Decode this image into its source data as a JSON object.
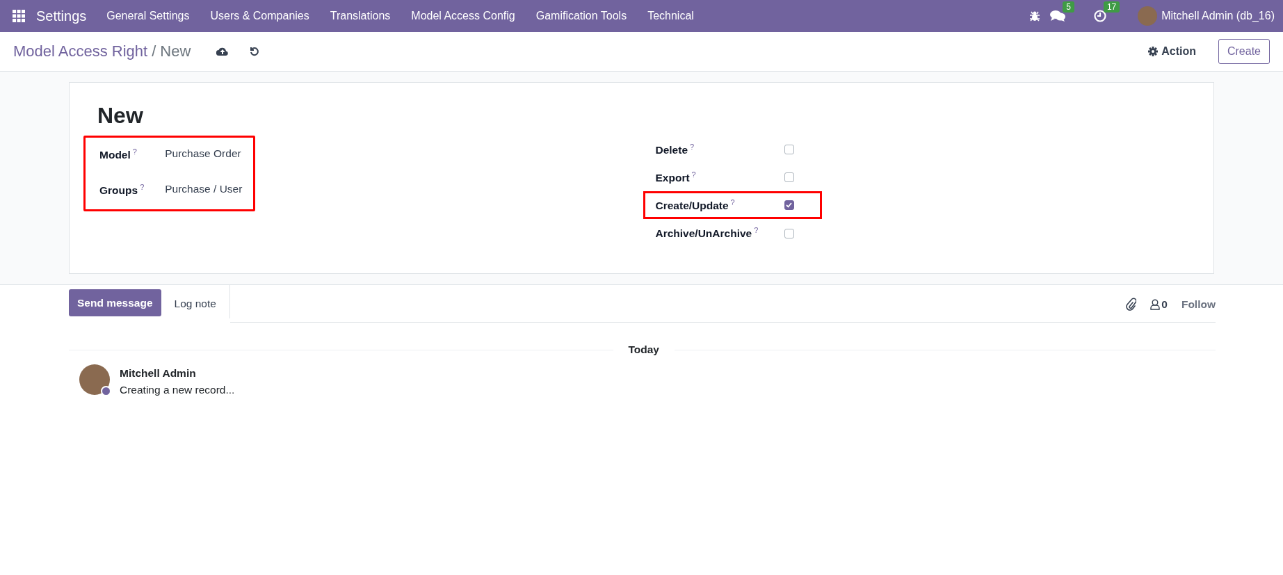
{
  "navbar": {
    "app": "Settings",
    "menus": [
      "General Settings",
      "Users & Companies",
      "Translations",
      "Model Access Config",
      "Gamification Tools",
      "Technical"
    ],
    "messages_badge": "5",
    "activities_badge": "17",
    "user": "Mitchell Admin (db_16)"
  },
  "control_panel": {
    "breadcrumb": "Model Access Right",
    "separator": "/",
    "current": "New",
    "action": "Action",
    "create": "Create"
  },
  "form": {
    "title": "New",
    "main_fields_highlighted": true,
    "main_fields": [
      {
        "label": "Model",
        "help": "?",
        "value": "Purchase Order"
      },
      {
        "label": "Groups",
        "help": "?",
        "value": "Purchase / User"
      }
    ],
    "permissions": [
      {
        "label": "Delete",
        "help": "?",
        "checked": false,
        "highlighted": false
      },
      {
        "label": "Export",
        "help": "?",
        "checked": false,
        "highlighted": false
      },
      {
        "label": "Create/Update",
        "help": "?",
        "checked": true,
        "highlighted": true
      },
      {
        "label": "Archive/UnArchive",
        "help": "?",
        "checked": false,
        "highlighted": false
      }
    ]
  },
  "chatter": {
    "tabs": [
      {
        "label": "Send message",
        "selected": true
      },
      {
        "label": "Log note",
        "selected": false
      }
    ],
    "followers": "0",
    "follow": "Follow",
    "date": "Today",
    "messages": [
      {
        "author": "Mitchell Admin",
        "body": "Creating a new record...",
        "online": true
      }
    ]
  }
}
